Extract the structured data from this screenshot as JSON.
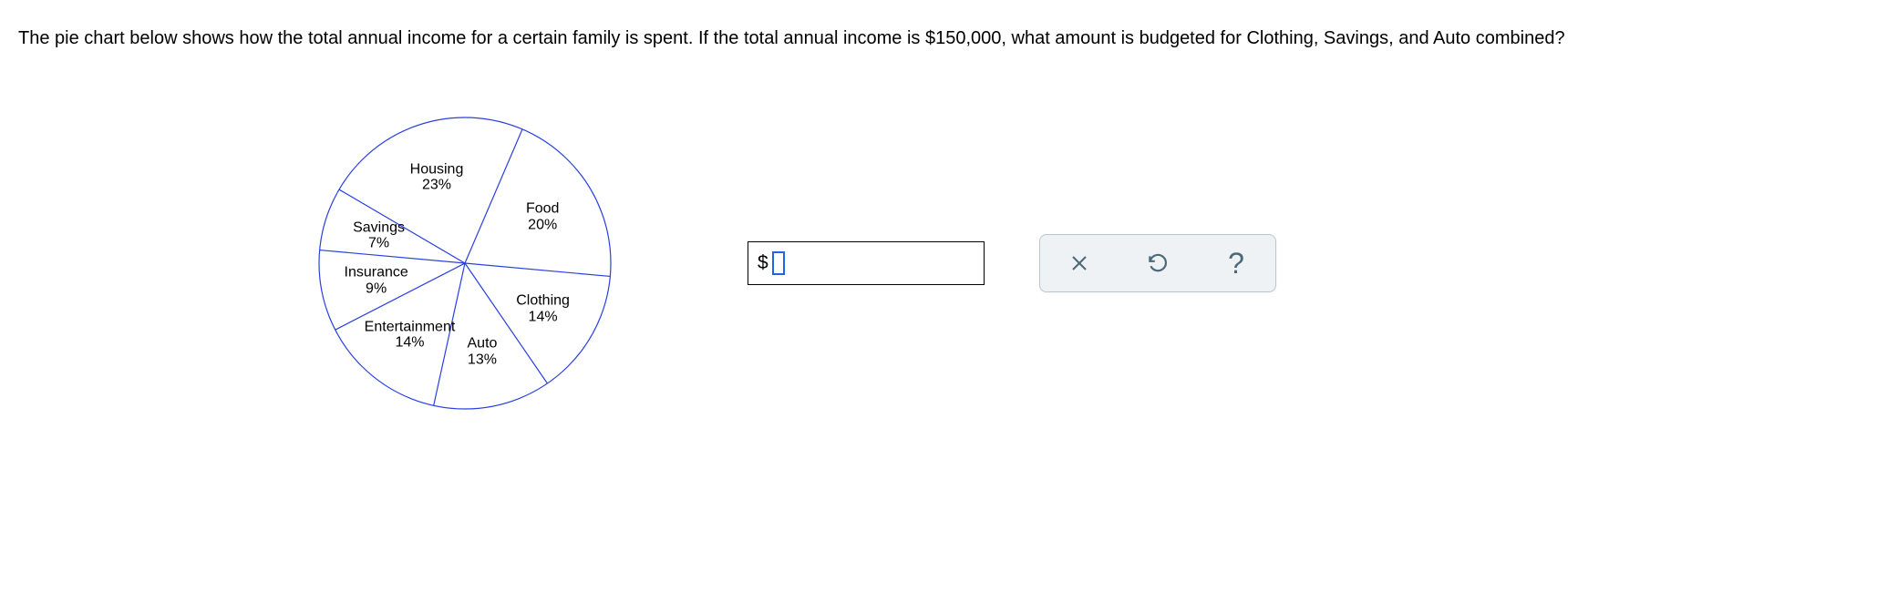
{
  "question_text": "The pie chart below shows how the total annual income for a certain family is spent. If the total annual income is $150,000, what amount is budgeted for Clothing, Savings, and Auto combined?",
  "chart_data": {
    "type": "pie",
    "title": "",
    "slices": [
      {
        "label": "Housing",
        "percent": 23
      },
      {
        "label": "Food",
        "percent": 20
      },
      {
        "label": "Clothing",
        "percent": 14
      },
      {
        "label": "Auto",
        "percent": 13
      },
      {
        "label": "Entertainment",
        "percent": 14
      },
      {
        "label": "Insurance",
        "percent": 9
      },
      {
        "label": "Savings",
        "percent": 7
      }
    ]
  },
  "answer": {
    "currency_symbol": "$",
    "value": "",
    "placeholder": ""
  },
  "tools": {
    "clear_label": "Clear",
    "reset_label": "Reset",
    "help_label": "Help"
  },
  "colors": {
    "stroke": "#2a3fe0",
    "toolbox_bg": "#eef2f4",
    "toolbox_icon": "#4a6a78",
    "cursor": "#1e66e6"
  }
}
